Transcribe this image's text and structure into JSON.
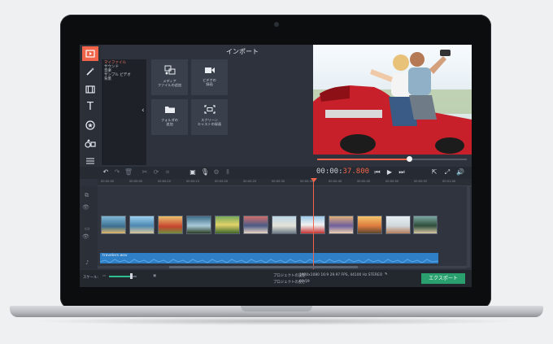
{
  "app": {
    "panel_title": "インポート",
    "categories": [
      "マイファイル",
      "サウンド",
      "音楽",
      "サンプル ビデオ",
      "背景"
    ],
    "selected_category": "マイファイル",
    "tiles": [
      {
        "icon": "media-files-icon",
        "label1": "メディア",
        "label2": "ファイルの追加"
      },
      {
        "icon": "video-camera-icon",
        "label1": "ビデオの",
        "label2": "録画"
      },
      {
        "icon": "folder-icon",
        "label1": "フォルダの",
        "label2": "追加"
      },
      {
        "icon": "screen-capture-icon",
        "label1": "スクリーン",
        "label2": "キャストの録画"
      }
    ],
    "timecode": {
      "dim": "00:00:",
      "accent": "37.800"
    },
    "ruler_ticks": [
      "00:00:00",
      "00:00:05",
      "00:00:10",
      "00:00:15",
      "00:00:20",
      "00:00:25",
      "00:00:30",
      "00:00:35",
      "00:00:40",
      "00:00:45",
      "00:00:50",
      "00:00:55",
      "00:01:00"
    ],
    "audio_clip": "travelers.wav",
    "scale_label": "スケール:",
    "zoom_level": 0.8,
    "playback_progress": 0.6,
    "project_settings_label": "プロジェクトの設定:",
    "project_settings_value": "1920x1080 16:9 29.97 FPS, 44100 Hz STEREO",
    "project_length_label": "プロジェクトの長さ:",
    "project_length_value": "00:59",
    "export_label": "エクスポート"
  },
  "colors": {
    "accent": "#f0654a",
    "export": "#2aa06e",
    "audio": "#2f7fc6"
  }
}
